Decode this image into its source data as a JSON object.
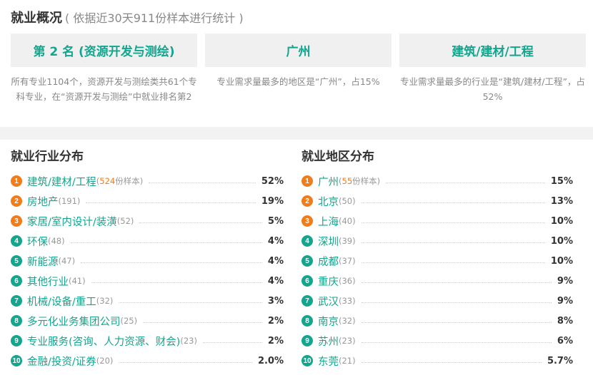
{
  "overview": {
    "title": "就业概况",
    "subtitle": "( 依据近30天911份样本进行统计 )",
    "cards": [
      {
        "value": "第 2 名 (资源开发与测绘)",
        "desc": "所有专业1104个，资源开发与测绘类共61个专科专业，在“资源开发与测绘”中就业排名第2"
      },
      {
        "value": "广州",
        "desc": "专业需求量最多的地区是“广州”，占15%"
      },
      {
        "value": "建筑/建材/工程",
        "desc": "专业需求量最多的行业是“建筑/建材/工程”，占52%"
      }
    ]
  },
  "industry": {
    "title": "就业行业分布",
    "items": [
      {
        "rank": "1",
        "name": "建筑/建材/工程",
        "count_prefix": "(",
        "count": "524",
        "count_suffix": "份样本)",
        "pct": "52%"
      },
      {
        "rank": "2",
        "name": "房地产",
        "count_prefix": "(191)",
        "count": "",
        "count_suffix": "",
        "pct": "19%"
      },
      {
        "rank": "3",
        "name": "家居/室内设计/装潢",
        "count_prefix": "(52)",
        "count": "",
        "count_suffix": "",
        "pct": "5%"
      },
      {
        "rank": "4",
        "name": "环保",
        "count_prefix": "(48)",
        "count": "",
        "count_suffix": "",
        "pct": "4%"
      },
      {
        "rank": "5",
        "name": "新能源",
        "count_prefix": "(47)",
        "count": "",
        "count_suffix": "",
        "pct": "4%"
      },
      {
        "rank": "6",
        "name": "其他行业",
        "count_prefix": "(41)",
        "count": "",
        "count_suffix": "",
        "pct": "4%"
      },
      {
        "rank": "7",
        "name": "机械/设备/重工",
        "count_prefix": "(32)",
        "count": "",
        "count_suffix": "",
        "pct": "3%"
      },
      {
        "rank": "8",
        "name": "多元化业务集团公司",
        "count_prefix": "(25)",
        "count": "",
        "count_suffix": "",
        "pct": "2%"
      },
      {
        "rank": "9",
        "name": "专业服务(咨询、人力资源、财会)",
        "count_prefix": "(23)",
        "count": "",
        "count_suffix": "",
        "pct": "2%"
      },
      {
        "rank": "10",
        "name": "金融/投资/证券",
        "count_prefix": "(20)",
        "count": "",
        "count_suffix": "",
        "pct": "2.0%"
      }
    ]
  },
  "region": {
    "title": "就业地区分布",
    "items": [
      {
        "rank": "1",
        "name": "广州",
        "count_prefix": "(",
        "count": "55",
        "count_suffix": "份样本)",
        "pct": "15%"
      },
      {
        "rank": "2",
        "name": "北京",
        "count_prefix": "(50)",
        "count": "",
        "count_suffix": "",
        "pct": "13%"
      },
      {
        "rank": "3",
        "name": "上海",
        "count_prefix": "(40)",
        "count": "",
        "count_suffix": "",
        "pct": "10%"
      },
      {
        "rank": "4",
        "name": "深圳",
        "count_prefix": "(39)",
        "count": "",
        "count_suffix": "",
        "pct": "10%"
      },
      {
        "rank": "5",
        "name": "成都",
        "count_prefix": "(37)",
        "count": "",
        "count_suffix": "",
        "pct": "10%"
      },
      {
        "rank": "6",
        "name": "重庆",
        "count_prefix": "(36)",
        "count": "",
        "count_suffix": "",
        "pct": "9%"
      },
      {
        "rank": "7",
        "name": "武汉",
        "count_prefix": "(33)",
        "count": "",
        "count_suffix": "",
        "pct": "9%"
      },
      {
        "rank": "8",
        "name": "南京",
        "count_prefix": "(32)",
        "count": "",
        "count_suffix": "",
        "pct": "8%"
      },
      {
        "rank": "9",
        "name": "苏州",
        "count_prefix": "(23)",
        "count": "",
        "count_suffix": "",
        "pct": "6%"
      },
      {
        "rank": "10",
        "name": "东莞",
        "count_prefix": "(21)",
        "count": "",
        "count_suffix": "",
        "pct": "5.7%"
      }
    ]
  },
  "colors": {
    "accent": "#13a58d",
    "top_rank": "#f07c1a",
    "card_bg": "#f0f0f0"
  }
}
